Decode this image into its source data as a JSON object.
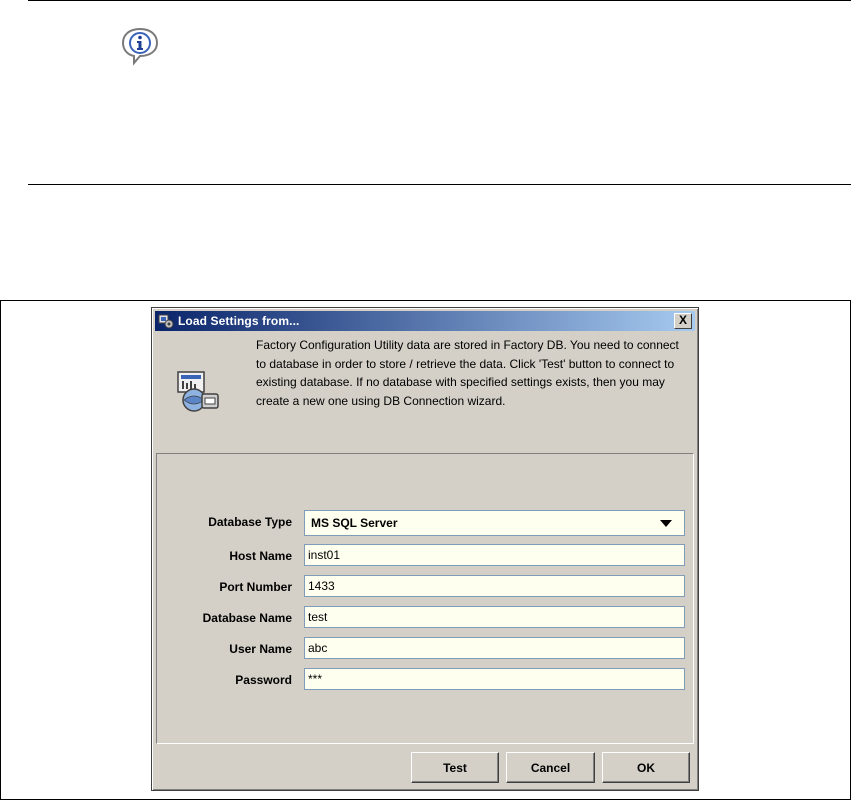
{
  "dialog": {
    "title": "Load Settings from...",
    "close_label": "X",
    "description": "Factory Configuration Utility data are stored in Factory DB. You need to connect to database in order to store / retrieve the data. Click 'Test' button to connect to existing database. If no database with specified settings exists, then you may create a new one using DB Connection wizard."
  },
  "form": {
    "database_type_label": "Database Type",
    "database_type_value": "MS SQL Server",
    "host_name_label": "Host Name",
    "host_name_value": "inst01",
    "port_number_label": "Port Number",
    "port_number_value": "1433",
    "database_name_label": "Database Name",
    "database_name_value": "test",
    "user_name_label": "User Name",
    "user_name_value": "abc",
    "password_label": "Password",
    "password_value": "***"
  },
  "buttons": {
    "test": "Test",
    "cancel": "Cancel",
    "ok": "OK"
  },
  "icons": {
    "info": "info-speech-bubble-icon",
    "title": "database-settings-icon",
    "header": "database-connection-icon"
  },
  "colors": {
    "titlebar_start": "#0a246a",
    "titlebar_end": "#a6caf0",
    "dialog_bg": "#d4d0c8",
    "field_bg": "#fffff0"
  }
}
